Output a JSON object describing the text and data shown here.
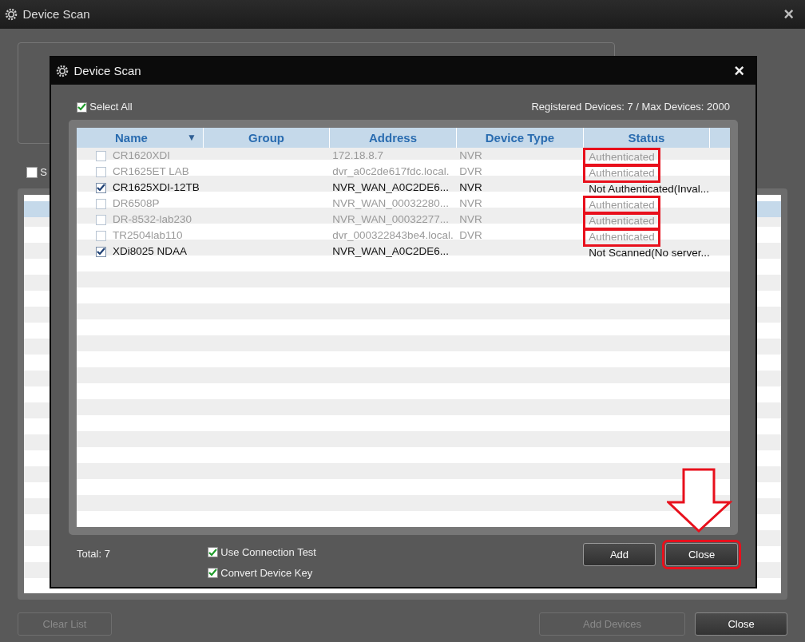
{
  "window": {
    "title": "Device Scan",
    "close": "×"
  },
  "background": {
    "partial_checkbox_label": "S",
    "partial_checkbox_checked": false,
    "buttons": [
      {
        "label": "Clear List",
        "disabled": true
      },
      {
        "label": "Add Devices",
        "disabled": true
      },
      {
        "label": "Close",
        "disabled": false
      }
    ]
  },
  "dialog": {
    "title": "Device Scan",
    "close": "×",
    "select_all": {
      "label": "Select All",
      "checked": true
    },
    "registered": "Registered Devices: 7 / Max Devices: 2000",
    "table": {
      "columns": [
        "Name",
        "Group",
        "Address",
        "Device Type",
        "Status"
      ],
      "sort_indicator": "▼",
      "rows": [
        {
          "name": "CR1620XDI",
          "address": "172.18.8.7",
          "type": "NVR",
          "status": "Authenticated",
          "checked": false,
          "disabled": true,
          "highlighted": true
        },
        {
          "name": "CR1625ET LAB",
          "address": "dvr_a0c2de617fdc.local.",
          "type": "DVR",
          "status": "Authenticated",
          "checked": false,
          "disabled": true,
          "highlighted": true
        },
        {
          "name": "CR1625XDI-12TB",
          "address": "NVR_WAN_A0C2DE6...",
          "type": "NVR",
          "status": "Not Authenticated(Inval...",
          "checked": true,
          "disabled": false,
          "highlighted": false
        },
        {
          "name": "DR6508P",
          "address": "NVR_WAN_00032280...",
          "type": "NVR",
          "status": "Authenticated",
          "checked": false,
          "disabled": true,
          "highlighted": true
        },
        {
          "name": "DR-8532-lab230",
          "address": "NVR_WAN_00032277...",
          "type": "NVR",
          "status": "Authenticated",
          "checked": false,
          "disabled": true,
          "highlighted": true
        },
        {
          "name": "TR2504lab110",
          "address": "dvr_000322843be4.local.",
          "type": "DVR",
          "status": "Authenticated",
          "checked": false,
          "disabled": true,
          "highlighted": true
        },
        {
          "name": "XDi8025 NDAA",
          "address": "NVR_WAN_A0C2DE6...",
          "status": "Not Scanned(No server...",
          "checked": true,
          "disabled": false,
          "highlighted": false
        }
      ]
    },
    "total": "Total: 7",
    "options": [
      {
        "label": "Use Connection Test",
        "checked": true
      },
      {
        "label": "Convert Device Key",
        "checked": true
      }
    ],
    "buttons": [
      {
        "label": "Add",
        "highlighted": false
      },
      {
        "label": "Close",
        "highlighted": true
      }
    ]
  }
}
